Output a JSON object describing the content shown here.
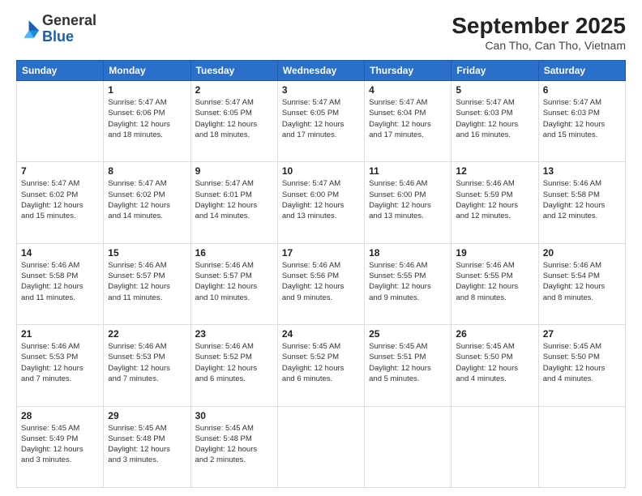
{
  "header": {
    "logo_general": "General",
    "logo_blue": "Blue",
    "month_title": "September 2025",
    "location": "Can Tho, Can Tho, Vietnam"
  },
  "weekdays": [
    "Sunday",
    "Monday",
    "Tuesday",
    "Wednesday",
    "Thursday",
    "Friday",
    "Saturday"
  ],
  "weeks": [
    [
      {
        "day": null,
        "info": null
      },
      {
        "day": "1",
        "info": "Sunrise: 5:47 AM\nSunset: 6:06 PM\nDaylight: 12 hours\nand 18 minutes."
      },
      {
        "day": "2",
        "info": "Sunrise: 5:47 AM\nSunset: 6:05 PM\nDaylight: 12 hours\nand 18 minutes."
      },
      {
        "day": "3",
        "info": "Sunrise: 5:47 AM\nSunset: 6:05 PM\nDaylight: 12 hours\nand 17 minutes."
      },
      {
        "day": "4",
        "info": "Sunrise: 5:47 AM\nSunset: 6:04 PM\nDaylight: 12 hours\nand 17 minutes."
      },
      {
        "day": "5",
        "info": "Sunrise: 5:47 AM\nSunset: 6:03 PM\nDaylight: 12 hours\nand 16 minutes."
      },
      {
        "day": "6",
        "info": "Sunrise: 5:47 AM\nSunset: 6:03 PM\nDaylight: 12 hours\nand 15 minutes."
      }
    ],
    [
      {
        "day": "7",
        "info": "Sunrise: 5:47 AM\nSunset: 6:02 PM\nDaylight: 12 hours\nand 15 minutes."
      },
      {
        "day": "8",
        "info": "Sunrise: 5:47 AM\nSunset: 6:02 PM\nDaylight: 12 hours\nand 14 minutes."
      },
      {
        "day": "9",
        "info": "Sunrise: 5:47 AM\nSunset: 6:01 PM\nDaylight: 12 hours\nand 14 minutes."
      },
      {
        "day": "10",
        "info": "Sunrise: 5:47 AM\nSunset: 6:00 PM\nDaylight: 12 hours\nand 13 minutes."
      },
      {
        "day": "11",
        "info": "Sunrise: 5:46 AM\nSunset: 6:00 PM\nDaylight: 12 hours\nand 13 minutes."
      },
      {
        "day": "12",
        "info": "Sunrise: 5:46 AM\nSunset: 5:59 PM\nDaylight: 12 hours\nand 12 minutes."
      },
      {
        "day": "13",
        "info": "Sunrise: 5:46 AM\nSunset: 5:58 PM\nDaylight: 12 hours\nand 12 minutes."
      }
    ],
    [
      {
        "day": "14",
        "info": "Sunrise: 5:46 AM\nSunset: 5:58 PM\nDaylight: 12 hours\nand 11 minutes."
      },
      {
        "day": "15",
        "info": "Sunrise: 5:46 AM\nSunset: 5:57 PM\nDaylight: 12 hours\nand 11 minutes."
      },
      {
        "day": "16",
        "info": "Sunrise: 5:46 AM\nSunset: 5:57 PM\nDaylight: 12 hours\nand 10 minutes."
      },
      {
        "day": "17",
        "info": "Sunrise: 5:46 AM\nSunset: 5:56 PM\nDaylight: 12 hours\nand 9 minutes."
      },
      {
        "day": "18",
        "info": "Sunrise: 5:46 AM\nSunset: 5:55 PM\nDaylight: 12 hours\nand 9 minutes."
      },
      {
        "day": "19",
        "info": "Sunrise: 5:46 AM\nSunset: 5:55 PM\nDaylight: 12 hours\nand 8 minutes."
      },
      {
        "day": "20",
        "info": "Sunrise: 5:46 AM\nSunset: 5:54 PM\nDaylight: 12 hours\nand 8 minutes."
      }
    ],
    [
      {
        "day": "21",
        "info": "Sunrise: 5:46 AM\nSunset: 5:53 PM\nDaylight: 12 hours\nand 7 minutes."
      },
      {
        "day": "22",
        "info": "Sunrise: 5:46 AM\nSunset: 5:53 PM\nDaylight: 12 hours\nand 7 minutes."
      },
      {
        "day": "23",
        "info": "Sunrise: 5:46 AM\nSunset: 5:52 PM\nDaylight: 12 hours\nand 6 minutes."
      },
      {
        "day": "24",
        "info": "Sunrise: 5:45 AM\nSunset: 5:52 PM\nDaylight: 12 hours\nand 6 minutes."
      },
      {
        "day": "25",
        "info": "Sunrise: 5:45 AM\nSunset: 5:51 PM\nDaylight: 12 hours\nand 5 minutes."
      },
      {
        "day": "26",
        "info": "Sunrise: 5:45 AM\nSunset: 5:50 PM\nDaylight: 12 hours\nand 4 minutes."
      },
      {
        "day": "27",
        "info": "Sunrise: 5:45 AM\nSunset: 5:50 PM\nDaylight: 12 hours\nand 4 minutes."
      }
    ],
    [
      {
        "day": "28",
        "info": "Sunrise: 5:45 AM\nSunset: 5:49 PM\nDaylight: 12 hours\nand 3 minutes."
      },
      {
        "day": "29",
        "info": "Sunrise: 5:45 AM\nSunset: 5:48 PM\nDaylight: 12 hours\nand 3 minutes."
      },
      {
        "day": "30",
        "info": "Sunrise: 5:45 AM\nSunset: 5:48 PM\nDaylight: 12 hours\nand 2 minutes."
      },
      {
        "day": null,
        "info": null
      },
      {
        "day": null,
        "info": null
      },
      {
        "day": null,
        "info": null
      },
      {
        "day": null,
        "info": null
      }
    ]
  ]
}
